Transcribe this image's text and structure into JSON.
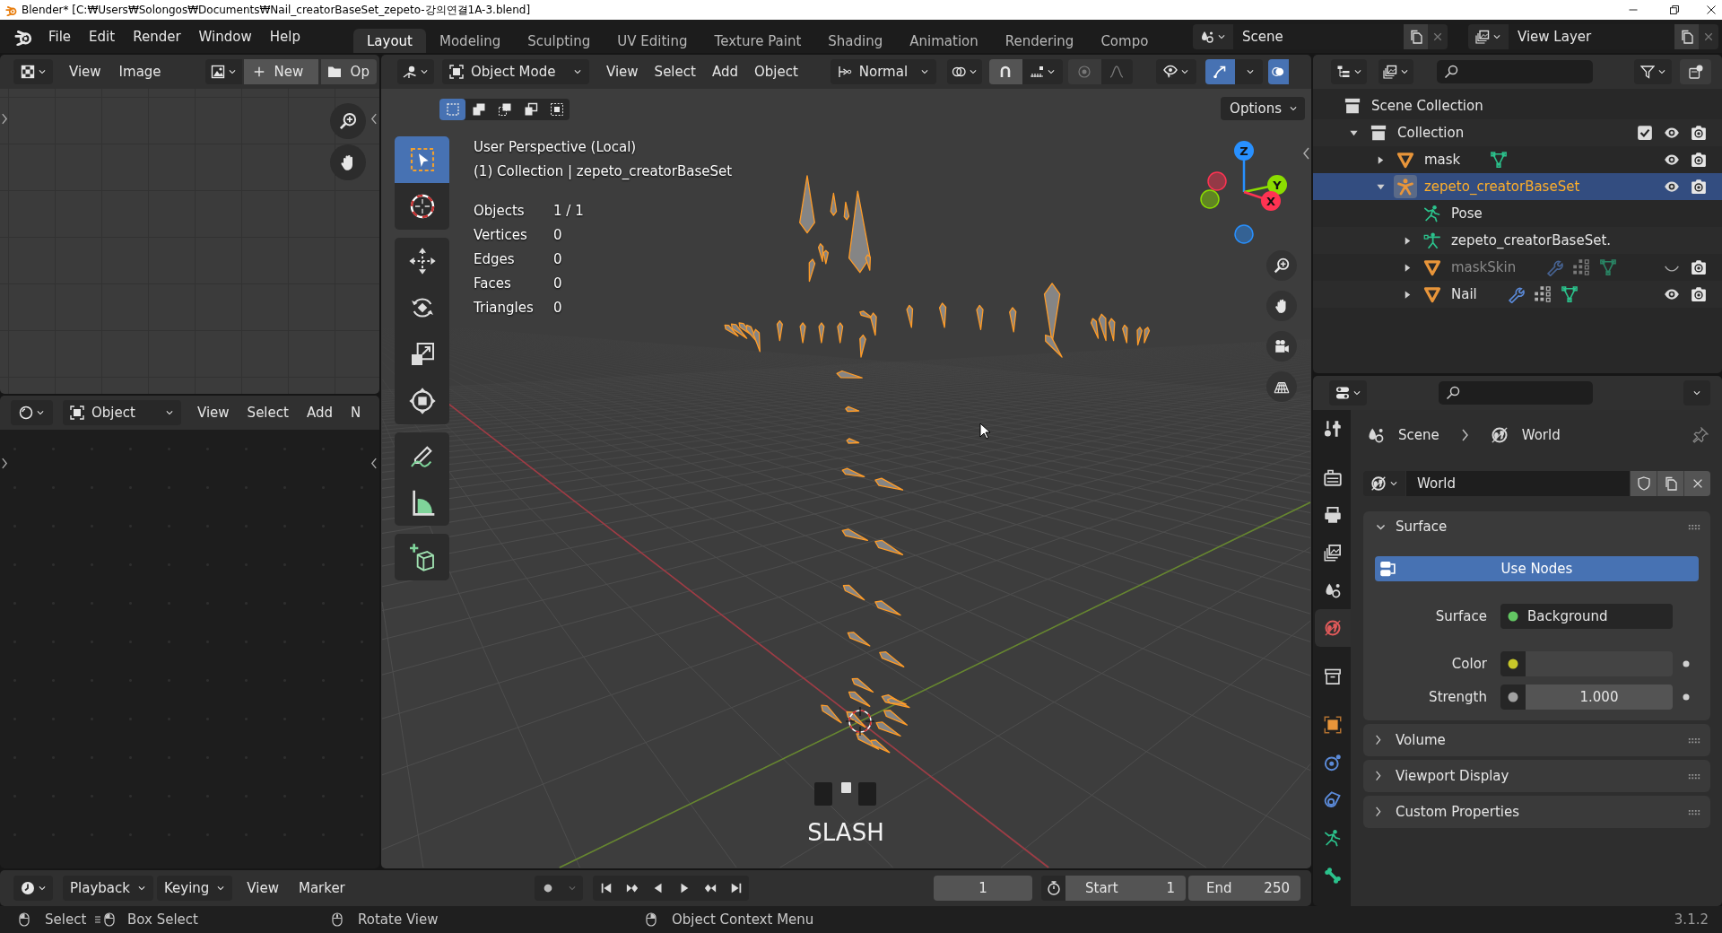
{
  "window": {
    "title": "Blender* [C:₩Users₩Solongos₩Documents₩Nail_creatorBaseSet_zepeto-강의연결1A-3.blend]"
  },
  "top_bar": {
    "menus": [
      "File",
      "Edit",
      "Render",
      "Window",
      "Help"
    ],
    "workspaces": [
      {
        "label": "Layout",
        "selected": true
      },
      {
        "label": "Modeling",
        "selected": false
      },
      {
        "label": "Sculpting",
        "selected": false
      },
      {
        "label": "UV Editing",
        "selected": false
      },
      {
        "label": "Texture Paint",
        "selected": false
      },
      {
        "label": "Shading",
        "selected": false
      },
      {
        "label": "Animation",
        "selected": false
      },
      {
        "label": "Rendering",
        "selected": false
      },
      {
        "label": "Compo",
        "selected": false
      }
    ],
    "scene": "Scene",
    "view_layer": "View Layer"
  },
  "image_editor": {
    "menus": [
      "View",
      "Image"
    ],
    "new_button": "New",
    "open_button": "Op"
  },
  "shader_editor": {
    "mode": "Object",
    "menus": [
      "View",
      "Select",
      "Add",
      "N"
    ]
  },
  "viewport": {
    "mode": "Object Mode",
    "menus": [
      "View",
      "Select",
      "Add",
      "Object"
    ],
    "orientation": "Normal",
    "gizmos_on": true,
    "overlays_on": true,
    "select_modes": [
      {
        "kind": "set",
        "selected": true
      },
      {
        "kind": "extend",
        "selected": false
      },
      {
        "kind": "subtract",
        "selected": false
      },
      {
        "kind": "invert",
        "selected": false
      },
      {
        "kind": "intersect",
        "selected": false
      }
    ],
    "options": "Options",
    "tool_groups": [
      [
        {
          "kind": "select_box",
          "selected": true
        },
        {
          "kind": "cursor",
          "selected": false
        }
      ],
      [
        {
          "kind": "move",
          "selected": false
        },
        {
          "kind": "rotate",
          "selected": false
        },
        {
          "kind": "scale",
          "selected": false
        },
        {
          "kind": "transform",
          "selected": false
        }
      ],
      [
        {
          "kind": "annotate",
          "selected": false
        },
        {
          "kind": "measure",
          "selected": false
        }
      ],
      [
        {
          "kind": "add_cube",
          "selected": false
        }
      ]
    ],
    "view_name": "User Perspective (Local)",
    "context": "(1) Collection | zepeto_creatorBaseSet",
    "stats": [
      {
        "label": "Objects",
        "value": "1 / 1"
      },
      {
        "label": "Vertices",
        "value": "0"
      },
      {
        "label": "Edges",
        "value": "0"
      },
      {
        "label": "Faces",
        "value": "0"
      },
      {
        "label": "Triangles",
        "value": "0"
      }
    ],
    "axes": [
      {
        "label": "Z",
        "color": "#2890ff"
      },
      {
        "label": "Y",
        "color": "#8bdc00"
      },
      {
        "label": "X",
        "color": "#ff3352"
      }
    ],
    "key_display": "SLASH"
  },
  "outliner": {
    "tree": [
      {
        "label": "Scene Collection",
        "kind": "scene_collection",
        "selected": false,
        "children": [
          {
            "label": "Collection",
            "kind": "collection",
            "expanded": true,
            "selected": false,
            "checked": true,
            "visible": true,
            "renderable": true,
            "children": [
              {
                "label": "mask",
                "kind": "mesh",
                "expanded": false,
                "selected": false,
                "modifiers": false,
                "visible": true,
                "renderable": true
              },
              {
                "label": "zepeto_creatorBaseSet",
                "kind": "armature",
                "expanded": true,
                "selected": true,
                "visible": true,
                "renderable": true,
                "children": [
                  {
                    "label": "Pose",
                    "kind": "pose",
                    "selected": false
                  },
                  {
                    "label": "zepeto_creatorBaseSet.",
                    "kind": "armature_data",
                    "expanded": false,
                    "selected": false
                  },
                  {
                    "label": "maskSkin",
                    "kind": "mesh",
                    "expanded": false,
                    "selected": false,
                    "modifiers": true,
                    "visible": false,
                    "renderable": true
                  },
                  {
                    "label": "Nail",
                    "kind": "mesh",
                    "expanded": false,
                    "selected": false,
                    "modifiers": true,
                    "visible": true,
                    "renderable": true
                  }
                ]
              }
            ]
          }
        ]
      }
    ]
  },
  "properties": {
    "tab_groups": [
      [
        {
          "kind": "tool",
          "selected": false
        }
      ],
      [
        {
          "kind": "render",
          "selected": false
        },
        {
          "kind": "output",
          "selected": false
        },
        {
          "kind": "view_layer",
          "selected": false
        },
        {
          "kind": "scene",
          "selected": false
        },
        {
          "kind": "world",
          "selected": true
        }
      ],
      [
        {
          "kind": "collection",
          "selected": false
        }
      ],
      [
        {
          "kind": "object",
          "selected": false
        },
        {
          "kind": "physics",
          "selected": false
        },
        {
          "kind": "constraints",
          "selected": false
        },
        {
          "kind": "armature_data",
          "selected": false
        },
        {
          "kind": "bone",
          "selected": false
        }
      ]
    ],
    "breadcrumb": [
      {
        "kind": "scene",
        "label": "Scene"
      },
      {
        "kind": "world",
        "label": "World"
      }
    ],
    "datablock": "World",
    "panels": [
      {
        "label": "Surface",
        "expanded": true,
        "use_nodes": {
          "label": "Use Nodes",
          "on": true
        },
        "fields": [
          {
            "label": "Surface",
            "kind": "shader",
            "value": "Background",
            "color": "#63c763"
          },
          {
            "label": "Color",
            "kind": "color",
            "color": "#c7c729"
          },
          {
            "label": "Strength",
            "kind": "number",
            "value": "1.000",
            "color": "#a1a1a1"
          }
        ]
      },
      {
        "label": "Volume",
        "expanded": false
      },
      {
        "label": "Viewport Display",
        "expanded": false
      },
      {
        "label": "Custom Properties",
        "expanded": false
      }
    ]
  },
  "timeline": {
    "menus": [
      {
        "label": "Playback",
        "kind": "dropdown"
      },
      {
        "label": "Keying",
        "kind": "dropdown"
      },
      {
        "label": "View",
        "kind": "menu"
      },
      {
        "label": "Marker",
        "kind": "menu"
      }
    ],
    "current_frame": "1",
    "start": {
      "label": "Start",
      "value": "1"
    },
    "end": {
      "label": "End",
      "value": "250"
    }
  },
  "status_bar": {
    "hints": [
      {
        "kind": "left",
        "label": "Select"
      },
      {
        "kind": "left_drag",
        "label": "Box Select"
      },
      {
        "kind": "middle",
        "label": "Rotate View"
      },
      {
        "kind": "right",
        "label": "Object Context Menu"
      }
    ],
    "version": "3.1.2"
  }
}
